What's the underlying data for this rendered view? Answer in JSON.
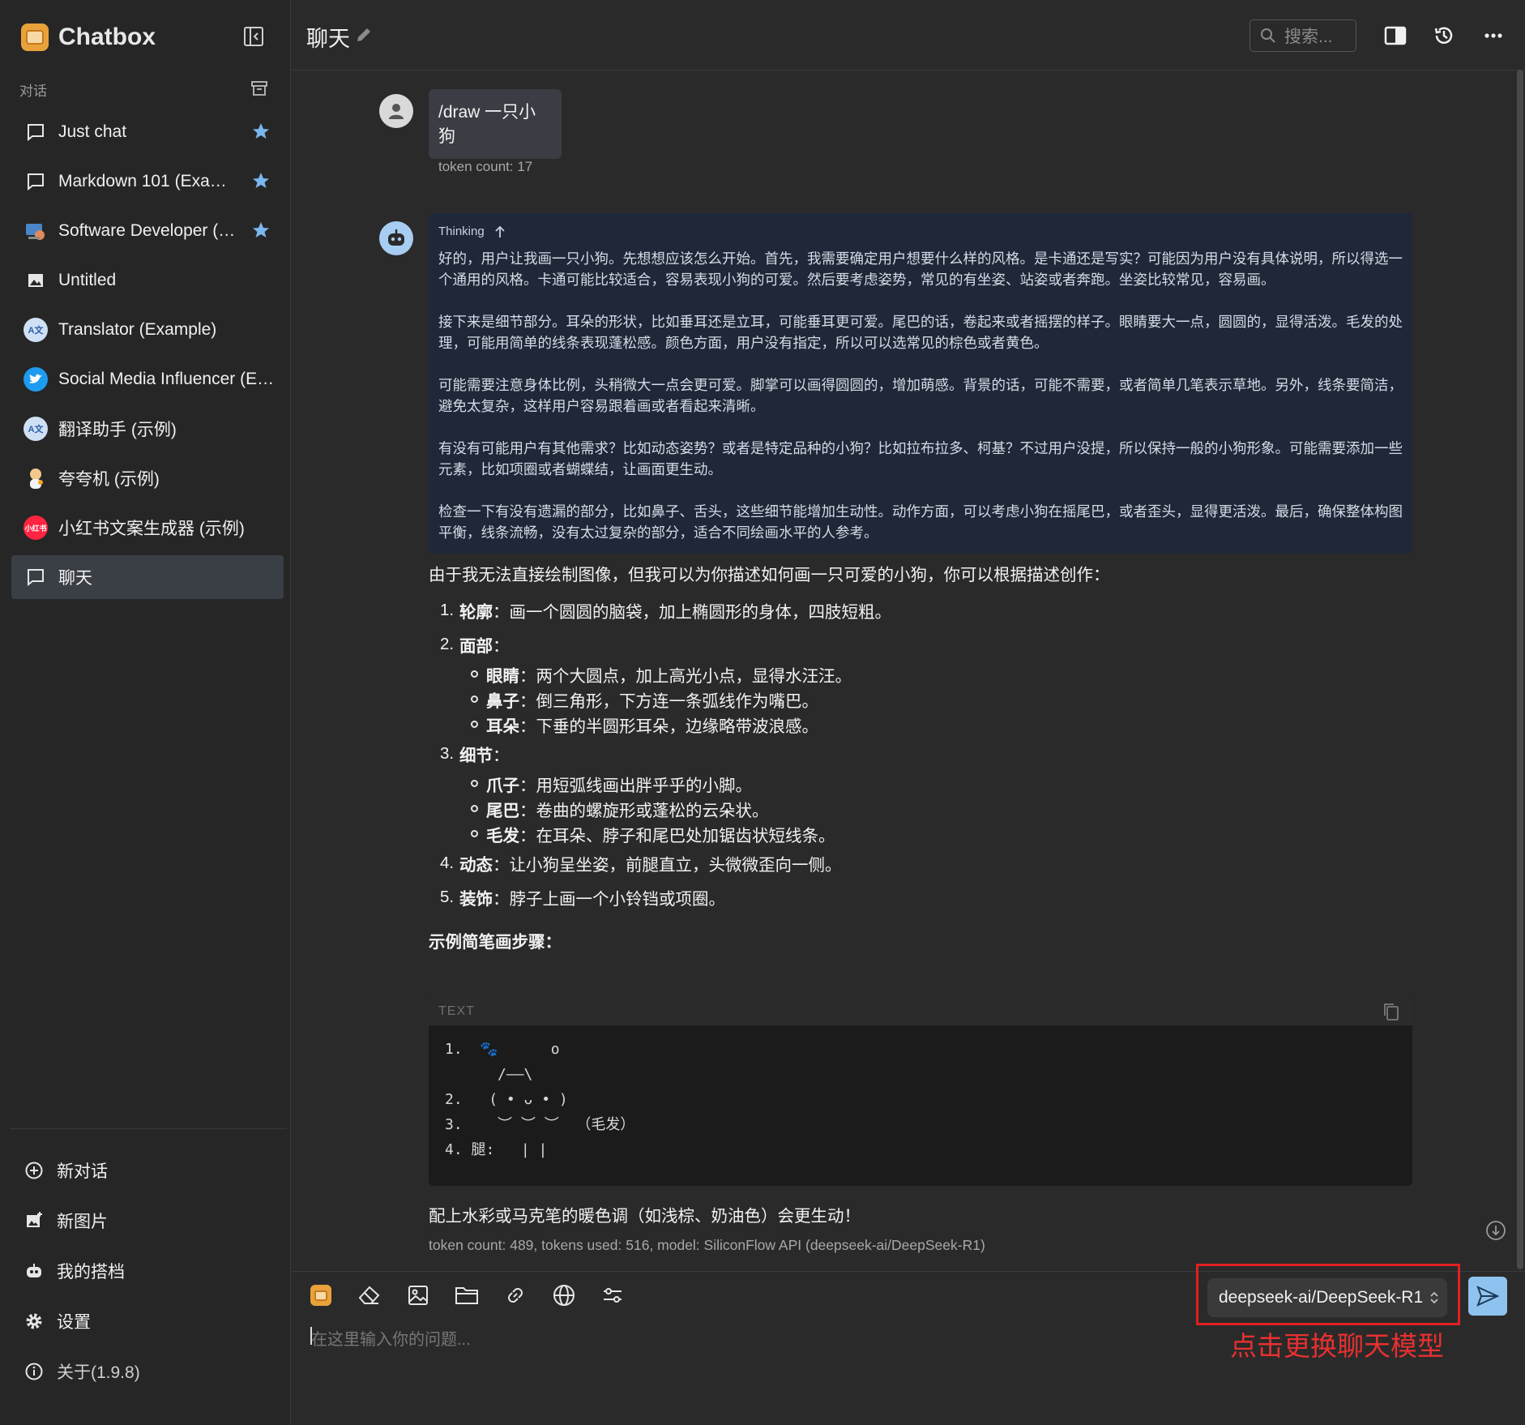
{
  "app": {
    "title": "Chatbox"
  },
  "sidebar": {
    "section_label": "对话",
    "conversations": [
      {
        "label": "Just chat",
        "icon": "chat-bubble-icon",
        "starred": true
      },
      {
        "label": "Markdown 101 (Example)",
        "icon": "chat-bubble-icon",
        "starred": true
      },
      {
        "label": "Software Developer (Example)",
        "icon": "developer-avatar",
        "starred": true
      },
      {
        "label": "Untitled",
        "icon": "image-icon",
        "starred": false
      },
      {
        "label": "Translator (Example)",
        "icon": "translator-avatar",
        "starred": false
      },
      {
        "label": "Social Media Influencer (Example)",
        "icon": "twitter-avatar",
        "starred": false
      },
      {
        "label": "翻译助手 (示例)",
        "icon": "translator-avatar",
        "starred": false
      },
      {
        "label": "夸夸机 (示例)",
        "icon": "cheer-avatar",
        "starred": false
      },
      {
        "label": "小红书文案生成器 (示例)",
        "icon": "xiaohongshu-avatar",
        "starred": false
      },
      {
        "label": "聊天",
        "icon": "chat-bubble-icon",
        "starred": false,
        "active": true
      }
    ],
    "xhs_badge": "小红书",
    "bottom": {
      "new_chat": "新对话",
      "new_image": "新图片",
      "my_copilots": "我的搭档",
      "settings": "设置",
      "about": "关于(1.9.8)"
    }
  },
  "header": {
    "title": "聊天",
    "search_placeholder": "搜索..."
  },
  "messages": {
    "user": {
      "text": "/draw 一只小狗",
      "token_info": "token count: 17"
    },
    "assistant": {
      "thinking_label": "Thinking",
      "thinking_paragraphs": [
        "好的，用户让我画一只小狗。先想想应该怎么开始。首先，我需要确定用户想要什么样的风格。是卡通还是写实？可能因为用户没有具体说明，所以得选一个通用的风格。卡通可能比较适合，容易表现小狗的可爱。然后要考虑姿势，常见的有坐姿、站姿或者奔跑。坐姿比较常见，容易画。",
        "接下来是细节部分。耳朵的形状，比如垂耳还是立耳，可能垂耳更可爱。尾巴的话，卷起来或者摇摆的样子。眼睛要大一点，圆圆的，显得活泼。毛发的处理，可能用简单的线条表现蓬松感。颜色方面，用户没有指定，所以可以选常见的棕色或者黄色。",
        "可能需要注意身体比例，头稍微大一点会更可爱。脚掌可以画得圆圆的，增加萌感。背景的话，可能不需要，或者简单几笔表示草地。另外，线条要简洁，避免太复杂，这样用户容易跟着画或者看起来清晰。",
        "有没有可能用户有其他需求？比如动态姿势？或者是特定品种的小狗？比如拉布拉多、柯基？不过用户没提，所以保持一般的小狗形象。可能需要添加一些元素，比如项圈或者蝴蝶结，让画面更生动。",
        "检查一下有没有遗漏的部分，比如鼻子、舌头，这些细节能增加生动性。动作方面，可以考虑小狗在摇尾巴，或者歪头，显得更活泼。最后，确保整体构图平衡，线条流畅，没有太过复杂的部分，适合不同绘画水平的人参考。"
      ],
      "intro": "由于我无法直接绘制图像，但我可以为你描述如何画一只可爱的小狗，你可以根据描述创作：",
      "steps": [
        {
          "num": "1.",
          "title": "轮廓",
          "text": "：画一个圆圆的脑袋，加上椭圆形的身体，四肢短粗。"
        },
        {
          "num": "2.",
          "title": "面部",
          "text": "：",
          "sub": [
            {
              "title": "眼睛",
              "text": "：两个大圆点，加上高光小点，显得水汪汪。"
            },
            {
              "title": "鼻子",
              "text": "：倒三角形，下方连一条弧线作为嘴巴。"
            },
            {
              "title": "耳朵",
              "text": "：下垂的半圆形耳朵，边缘略带波浪感。"
            }
          ]
        },
        {
          "num": "3.",
          "title": "细节",
          "text": "：",
          "sub": [
            {
              "title": "爪子",
              "text": "：用短弧线画出胖乎乎的小脚。"
            },
            {
              "title": "尾巴",
              "text": "：卷曲的螺旋形或蓬松的云朵状。"
            },
            {
              "title": "毛发",
              "text": "：在耳朵、脖子和尾巴处加锯齿状短线条。"
            }
          ]
        },
        {
          "num": "4.",
          "title": "动态",
          "text": "：让小狗呈坐姿，前腿直立，头微微歪向一侧。"
        },
        {
          "num": "5.",
          "title": "装饰",
          "text": "：脖子上画一个小铃铛或项圈。"
        }
      ],
      "example_heading": "示例简笔画步骤：",
      "code": {
        "lang": "TEXT",
        "lines": [
          {
            "prefix": "1.  ",
            "paw": "🐾",
            "rest": "      o"
          },
          {
            "prefix": "",
            "paw": "",
            "rest": "      /——\\"
          },
          {
            "prefix": "2.  ",
            "paw": "",
            "rest": " ( • ᴗ • )"
          },
          {
            "prefix": "3.  ",
            "paw": "",
            "rest": "  ︶ ︶ ︶  （毛发）"
          },
          {
            "prefix": "4. ",
            "paw": "",
            "rest": "腿:   | |"
          }
        ]
      },
      "closing": "配上水彩或马克笔的暖色调（如浅棕、奶油色）会更生动！",
      "meta": "token count: 489, tokens used: 516, model: SiliconFlow API (deepseek-ai/DeepSeek-R1)"
    }
  },
  "input": {
    "placeholder": "在这里输入你的问题...",
    "model": "deepseek-ai/DeepSeek-R1",
    "annotation": "点击更换聊天模型"
  },
  "colors": {
    "accent": "#8ec3ef",
    "star": "#7ab7ee",
    "thinking_bg": "#1f2838",
    "annotation_red": "#e02020"
  }
}
